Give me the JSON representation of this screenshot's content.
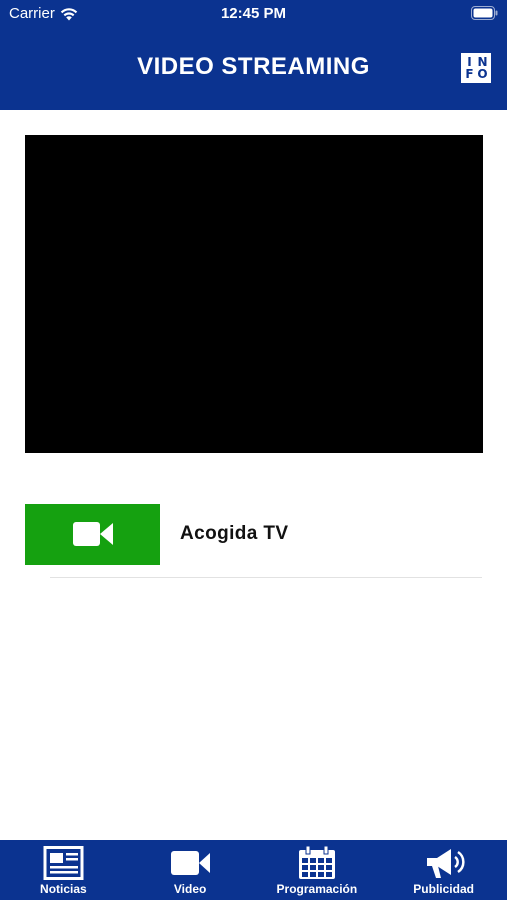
{
  "status_bar": {
    "carrier": "Carrier",
    "time": "12:45 PM",
    "wifi_icon": "wifi-icon",
    "battery_icon": "battery-icon"
  },
  "nav": {
    "title": "VIDEO STREAMING",
    "info_letters": [
      "I",
      "N",
      "F",
      "O"
    ]
  },
  "channels": [
    {
      "name": "Acogida TV",
      "icon": "video-camera-icon",
      "thumb_color": "#15a110"
    }
  ],
  "tabs": [
    {
      "label": "Noticias",
      "icon": "newspaper-icon"
    },
    {
      "label": "Video",
      "icon": "video-camera-icon"
    },
    {
      "label": "Programación",
      "icon": "calendar-icon"
    },
    {
      "label": "Publicidad",
      "icon": "megaphone-icon"
    }
  ],
  "colors": {
    "brand": "#0b3390",
    "channel_thumb": "#15a110",
    "player": "#000000"
  }
}
